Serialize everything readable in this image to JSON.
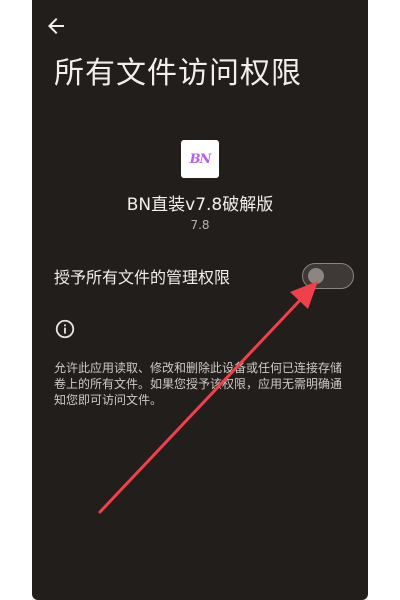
{
  "header": {
    "back_icon": "arrow-left-icon",
    "title": "所有文件访问权限"
  },
  "app": {
    "icon_text": "BN",
    "name": "BN直装v7.8破解版",
    "version": "7.8"
  },
  "permission": {
    "label": "授予所有文件的管理权限",
    "enabled": false
  },
  "info": {
    "icon": "info-icon",
    "description": "允许此应用读取、修改和删除此设备或任何已连接存储卷上的所有文件。如果您授予该权限，应用无需明确通知您即可访问文件。"
  },
  "annotation": {
    "arrow_color": "#f0404a"
  }
}
